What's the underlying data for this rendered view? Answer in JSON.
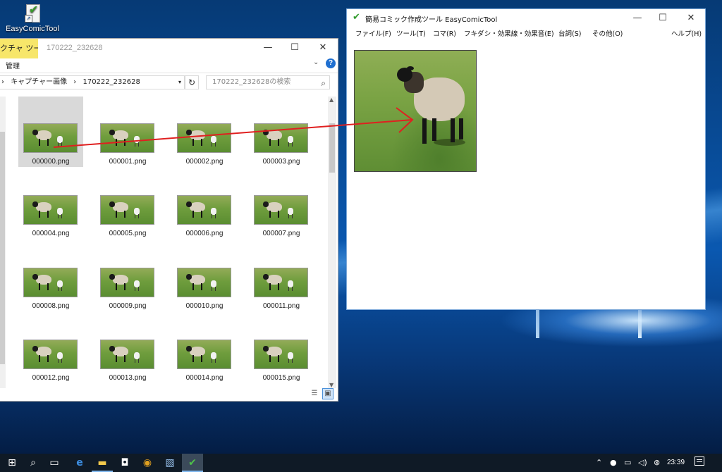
{
  "desktop": {
    "icon_label": "EasyComicTool"
  },
  "explorer": {
    "context_tab": "クチャ ツール",
    "title": "170222_232628",
    "ribbon_manage": "管理",
    "address": [
      "キャプチャー画像",
      "170222_232628"
    ],
    "search_placeholder": "170222_232628の検索",
    "files": [
      "000000.png",
      "000001.png",
      "000002.png",
      "000003.png",
      "000004.png",
      "000005.png",
      "000006.png",
      "000007.png",
      "000008.png",
      "000009.png",
      "000010.png",
      "000011.png",
      "000012.png",
      "000013.png",
      "000014.png",
      "000015.png"
    ],
    "selected_file": "000000.png"
  },
  "comic": {
    "title": "簡易コミック作成ツール EasyComicTool",
    "menu": [
      "ファイル(F)",
      "ツール(T)",
      "コマ(R)",
      "フキダシ・効果線・効果音(E)",
      "台詞(S)",
      "その他(O)",
      "ヘルプ(H)"
    ]
  },
  "taskbar": {
    "clock": "23:39",
    "icons": [
      "windows-start-icon",
      "search-icon",
      "task-view-icon",
      "edge-icon",
      "file-explorer-icon",
      "store-icon",
      "chrome-icon",
      "photos-icon",
      "easycomictool-icon"
    ]
  },
  "colors": {
    "context_tab": "#f7e66a",
    "arrow": "#e02020",
    "taskbar": "#0f1a26",
    "selection": "#d9d9d9"
  }
}
